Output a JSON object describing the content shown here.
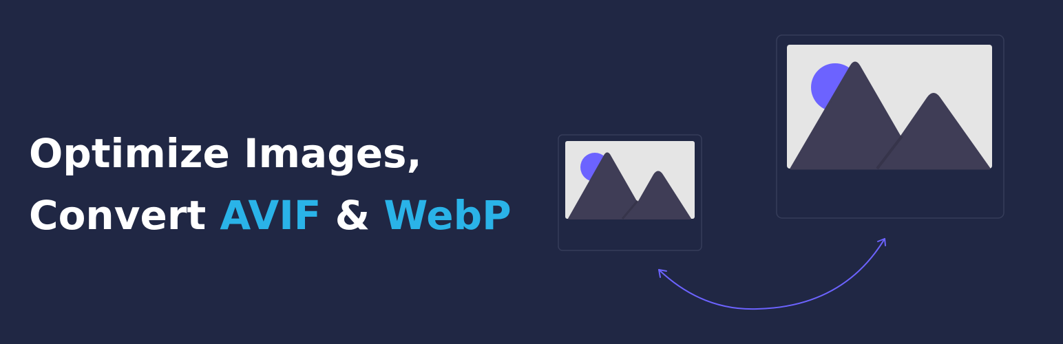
{
  "headline": {
    "line1": "Optimize Images,",
    "line2_prefix": "Convert ",
    "format1": "AVIF",
    "ampersand": " & ",
    "format2": "WebP"
  },
  "colors": {
    "background": "#202744",
    "text": "#ffffff",
    "accent": "#2ab3e8",
    "frame_stroke": "#363d5a",
    "image_bg": "#e5e5e5",
    "sun": "#6c63ff",
    "mountain": "#3f3d56",
    "arrow": "#6c63ff"
  },
  "icons": {
    "small_image": "image-placeholder-icon",
    "large_image": "image-placeholder-icon",
    "arrow": "curved-double-arrow-icon"
  }
}
